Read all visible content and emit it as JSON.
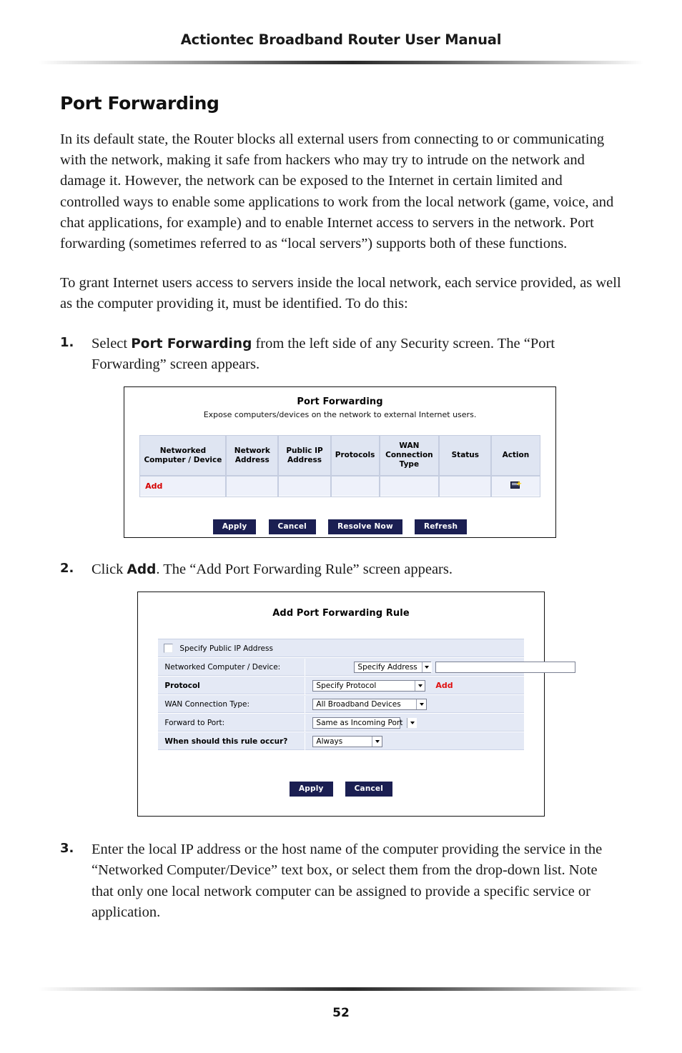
{
  "header": {
    "running_title": "Actiontec Broadband Router User Manual"
  },
  "section": {
    "title": "Port Forwarding",
    "paragraphs": [
      "In its default state, the Router blocks all external users from connecting to or communicating with the network, making it safe from hackers who may try to intrude on the network and damage it. However, the network can be exposed to the Internet in certain limited and controlled ways to enable some applications to work from the local network (game, voice, and chat applications, for example) and to enable Internet access to servers in the network. Port forwarding (sometimes referred to as “local servers”) supports both of these functions.",
      "To grant Internet users access to servers inside the local network, each service provided, as well as the computer providing it, must be identified. To do this:"
    ]
  },
  "steps": [
    {
      "number": "1.",
      "text_before": "Select ",
      "bold": "Port Forwarding",
      "text_after": " from the left side of any Security screen. The “Port Forwarding” screen appears."
    },
    {
      "number": "2.",
      "text_before": "Click ",
      "bold": "Add",
      "text_after": ". The “Add Port Forwarding Rule” screen appears."
    },
    {
      "number": "3.",
      "text_before": "Enter the local IP address or the host name of the computer providing the service in the “Networked Computer/Device” text box, or select them from the drop-down list. Note that only one local network computer can be assigned to provide a specific service or application.",
      "bold": "",
      "text_after": ""
    }
  ],
  "figure_port_forwarding": {
    "title": "Port Forwarding",
    "subtitle": "Expose computers/devices on the network to external Internet users.",
    "columns": [
      "Networked Computer / Device",
      "Network Address",
      "Public IP Address",
      "Protocols",
      "WAN Connection Type",
      "Status",
      "Action"
    ],
    "rows": [
      {
        "networked_computer": "Add",
        "network_address": "",
        "public_ip": "",
        "protocols": "",
        "wan_connection_type": "",
        "status": "",
        "action_icon": "add-computer-icon"
      }
    ],
    "buttons": [
      "Apply",
      "Cancel",
      "Resolve Now",
      "Refresh"
    ],
    "colors": {
      "button": "#1b1f52",
      "header_cell": "#dfe5f2",
      "row_cell": "#eef1fa",
      "add_link": "#d60000"
    }
  },
  "figure_add_rule": {
    "title": "Add Port Forwarding Rule",
    "checkbox": {
      "label": "Specify Public IP Address",
      "checked": false
    },
    "fields": [
      {
        "label": "Networked Computer / Device:",
        "bold": false,
        "select_value": "Specify Address",
        "text_value": "",
        "link": ""
      },
      {
        "label": "Protocol",
        "bold": true,
        "select_value": "Specify Protocol",
        "text_value": null,
        "link": "Add"
      },
      {
        "label": "WAN Connection Type:",
        "bold": false,
        "select_value": "All Broadband Devices",
        "text_value": null,
        "link": ""
      },
      {
        "label": "Forward to Port:",
        "bold": false,
        "select_value": "Same as Incoming Port",
        "text_value": null,
        "link": ""
      },
      {
        "label": "When should this rule occur?",
        "bold": true,
        "select_value": "Always",
        "text_value": null,
        "link": ""
      }
    ],
    "buttons": [
      "Apply",
      "Cancel"
    ],
    "colors": {
      "button": "#1b1f52",
      "panel": "#e4e9f5",
      "add_link": "#e01010"
    }
  },
  "footer": {
    "page_number": "52"
  }
}
